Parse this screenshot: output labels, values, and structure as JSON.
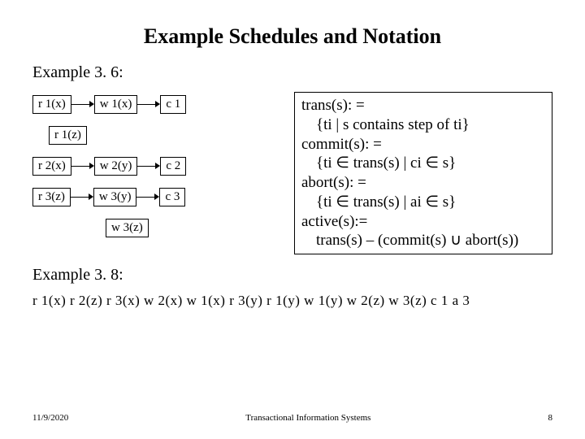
{
  "title": "Example Schedules and Notation",
  "ex36_label": "Example 3. 6:",
  "rows": {
    "r1x": "r 1(x)",
    "w1x": "w 1(x)",
    "c1": "c 1",
    "r1z": "r 1(z)",
    "r2x": "r 2(x)",
    "w2y": "w 2(y)",
    "c2": "c 2",
    "r3z": "r 3(z)",
    "w3y": "w 3(y)",
    "c3": "c 3",
    "w3z": "w 3(z)"
  },
  "def": {
    "l1": "trans(s): =",
    "l2": "{ti | s contains step of ti}",
    "l3": "commit(s): =",
    "l4": "{ti ∈ trans(s) | ci ∈ s}",
    "l5": "abort(s): =",
    "l6": "{ti ∈ trans(s) | ai ∈ s}",
    "l7": "active(s):=",
    "l8": "trans(s) – (commit(s) ∪ abort(s))"
  },
  "ex38_label": "Example 3. 8:",
  "seq": "r 1(x) r 2(z) r 3(x) w 2(x) w 1(x) r 3(y) r 1(y) w 1(y) w 2(z) w 3(z) c 1 a 3",
  "footer": {
    "date": "11/9/2020",
    "ctr": "Transactional Information Systems",
    "pg": "8"
  }
}
